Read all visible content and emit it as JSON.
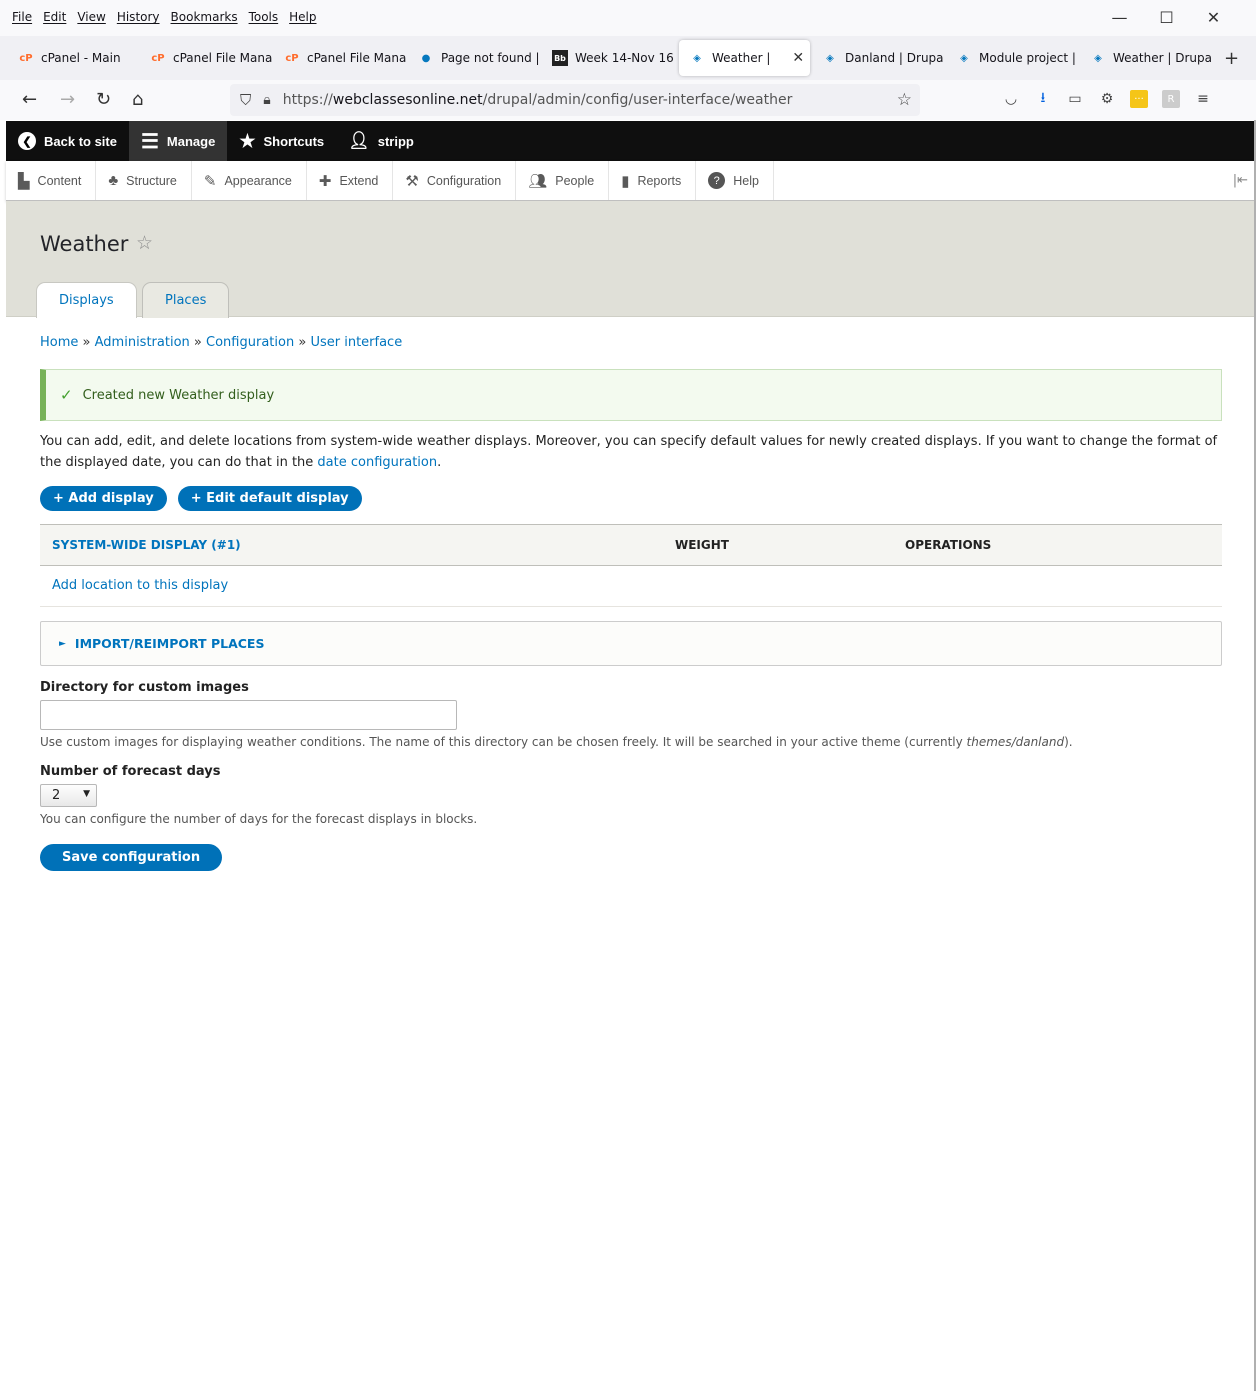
{
  "browser": {
    "menu": [
      "File",
      "Edit",
      "View",
      "History",
      "Bookmarks",
      "Tools",
      "Help"
    ],
    "window_controls": {
      "minimize": "—",
      "maximize": "☐",
      "close": "✕"
    },
    "tabs": [
      {
        "label": "cPanel - Main",
        "icon": "cpanel-icon"
      },
      {
        "label": "cPanel File Mana",
        "icon": "cpanel-icon"
      },
      {
        "label": "cPanel File Mana",
        "icon": "cpanel-icon"
      },
      {
        "label": "Page not found |",
        "icon": "drupal-icon"
      },
      {
        "label": "Week 14-Nov 16",
        "icon": "blackboard-icon"
      },
      {
        "label": "Weather |",
        "icon": "drupal-icon",
        "active": true
      },
      {
        "label": "Danland | Drupal",
        "icon": "drupal-icon"
      },
      {
        "label": "Module project |",
        "icon": "drupal-icon"
      },
      {
        "label": "Weather | Drupal",
        "icon": "drupal-icon"
      }
    ],
    "new_tab": "+",
    "url_prefix": "https://",
    "url_domain": "webclassesonline.net",
    "url_path": "/drupal/admin/config/user-interface/weather"
  },
  "toolbar": {
    "back_to_site": "Back to site",
    "manage": "Manage",
    "shortcuts": "Shortcuts",
    "user": "stripp"
  },
  "tray": {
    "items": [
      "Content",
      "Structure",
      "Appearance",
      "Extend",
      "Configuration",
      "People",
      "Reports",
      "Help"
    ]
  },
  "page": {
    "title": "Weather",
    "tabs": [
      "Displays",
      "Places"
    ]
  },
  "breadcrumb": [
    "Home",
    "Administration",
    "Configuration",
    "User interface"
  ],
  "breadcrumb_sep": "»",
  "status_message": "Created new Weather display",
  "description": {
    "text": "You can add, edit, and delete locations from system-wide weather displays. Moreover, you can specify default values for newly created displays. If you want to change the format of the displayed date, you can do that in the",
    "link": "date configuration",
    "end": "."
  },
  "buttons": {
    "add_display": "+ Add display",
    "edit_default": "+ Edit default display"
  },
  "table": {
    "headers": [
      "System-wide display (#1)",
      "Weight",
      "Operations"
    ],
    "rows": [
      "Add location to this display"
    ]
  },
  "details": {
    "label": "Import/reimport places"
  },
  "form": {
    "dir_label": "Directory for custom images",
    "dir_value": "",
    "dir_desc_pre": "Use custom images for displaying weather conditions. The name of this directory can be chosen freely. It will be searched in your active theme (currently",
    "dir_desc_theme": "themes/danland",
    "dir_desc_post": ").",
    "days_label": "Number of forecast days",
    "days_value": "2",
    "days_desc": "You can configure the number of days for the forecast displays in blocks.",
    "save": "Save configuration"
  },
  "colors": {
    "link": "#0074bd",
    "button": "#0071b8",
    "toolbar": "#0f0f0f",
    "header_bg": "#e0e0d8",
    "success": "#77b259"
  }
}
